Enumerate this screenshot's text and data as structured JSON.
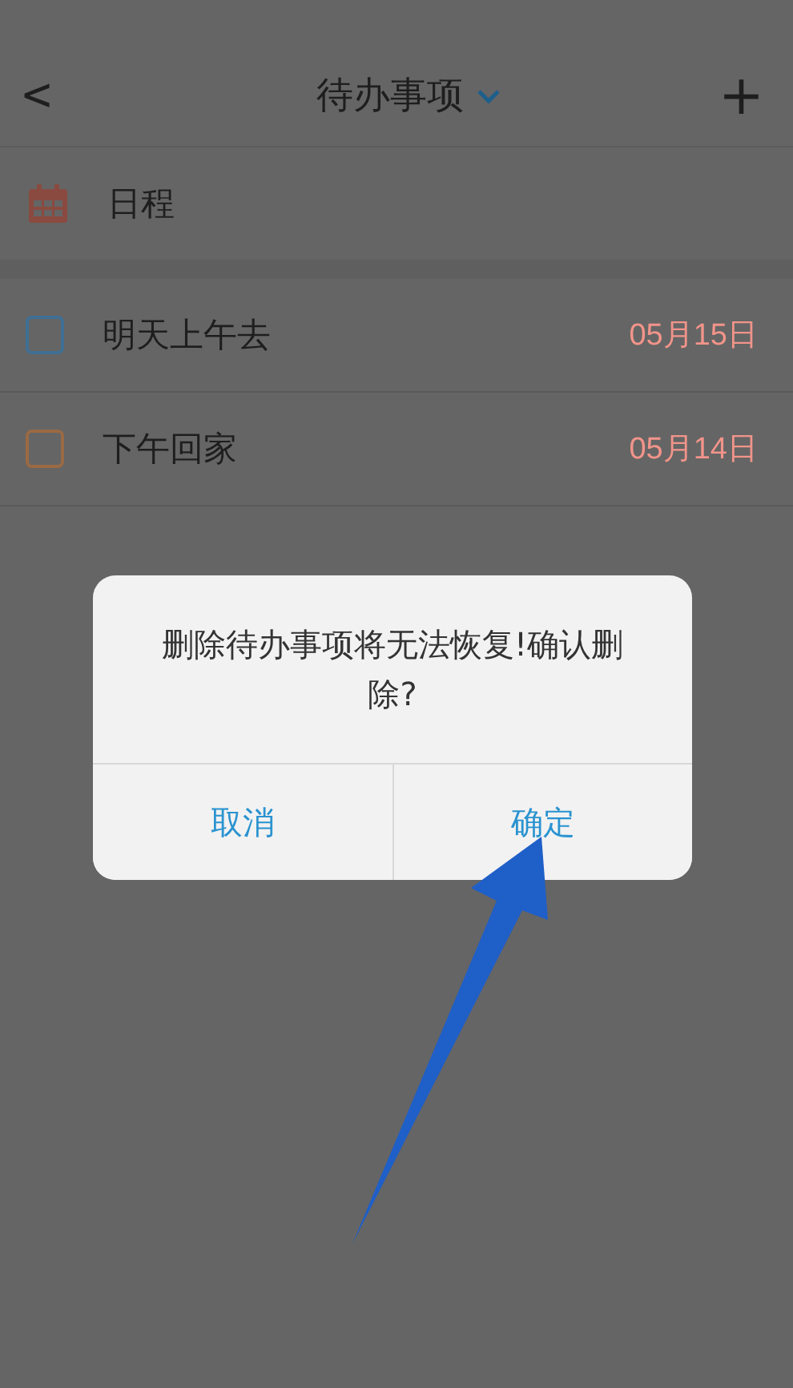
{
  "header": {
    "back_glyph": "<",
    "title": "待办事项",
    "add_glyph": "+"
  },
  "schedule": {
    "label": "日程"
  },
  "todos": [
    {
      "text": "明天上午去",
      "date": "05月15日",
      "checked": false,
      "color": "#3f6f94"
    },
    {
      "text": "下午回家",
      "date": "05月14日",
      "checked": false,
      "color": "#9a6a44"
    }
  ],
  "dialog": {
    "message": "删除待办事项将无法恢复!确认删除?",
    "buttons": [
      {
        "label": "取消"
      },
      {
        "label": "确定"
      }
    ]
  }
}
